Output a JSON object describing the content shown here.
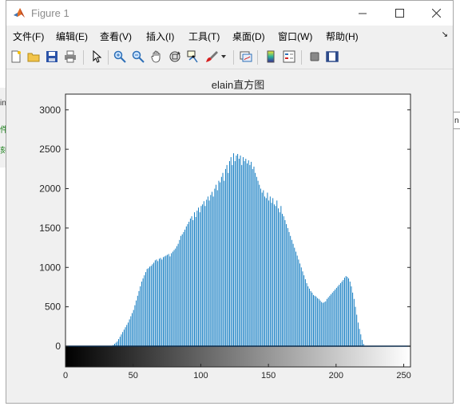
{
  "window": {
    "title": "Figure 1",
    "min_label": "Minimize",
    "max_label": "Maximize",
    "close_label": "Close"
  },
  "menu": [
    "文件(F)",
    "编辑(E)",
    "查看(V)",
    "插入(I)",
    "工具(T)",
    "桌面(D)",
    "窗口(W)",
    "帮助(H)"
  ],
  "toolbar": {
    "icons": [
      "new-figure-icon",
      "open-file-icon",
      "save-icon",
      "print-icon",
      "pointer-icon",
      "zoom-in-icon",
      "zoom-out-icon",
      "pan-icon",
      "rotate-3d-icon",
      "data-cursor-icon",
      "brush-icon",
      "link-plot-icon",
      "colorbar-icon",
      "legend-icon",
      "hide-plot-tools-icon",
      "show-plot-tools-icon"
    ]
  },
  "background": {
    "left_fragments": [
      "in",
      "件",
      "刻"
    ],
    "right_fragment": "n"
  },
  "chart_data": {
    "type": "bar",
    "title": "elain直方图",
    "xlabel": "",
    "ylabel": "",
    "xlim": [
      0,
      255
    ],
    "ylim": [
      0,
      3200
    ],
    "xticks": [
      0,
      50,
      100,
      150,
      200,
      250
    ],
    "yticks": [
      0,
      500,
      1000,
      1500,
      2000,
      2500,
      3000
    ],
    "bar_color": "#0072bd",
    "colorbar": "gray",
    "grid": false,
    "series": [
      {
        "x_start": 0,
        "values": [
          0,
          0,
          0,
          0,
          0,
          0,
          0,
          0,
          0,
          0,
          0,
          0,
          0,
          0,
          0,
          0,
          0,
          0,
          0,
          0,
          0,
          0,
          0,
          0,
          0,
          0,
          0,
          0,
          0,
          0,
          0,
          0,
          0,
          0,
          0,
          15,
          30,
          45,
          60,
          90,
          120,
          150,
          180,
          210,
          240,
          270,
          300,
          340,
          380,
          420,
          460,
          520,
          580,
          640,
          700,
          760,
          820,
          860,
          900,
          940,
          980,
          990,
          1010,
          1020,
          1040,
          1060,
          1090,
          1100,
          1080,
          1110,
          1120,
          1100,
          1130,
          1140,
          1150,
          1160,
          1170,
          1140,
          1180,
          1200,
          1220,
          1240,
          1270,
          1300,
          1350,
          1400,
          1420,
          1450,
          1480,
          1520,
          1550,
          1580,
          1620,
          1650,
          1600,
          1700,
          1640,
          1720,
          1760,
          1700,
          1780,
          1800,
          1840,
          1780,
          1860,
          1900,
          1850,
          1920,
          1960,
          1900,
          2000,
          2050,
          1980,
          2100,
          2080,
          2150,
          2200,
          2100,
          2250,
          2300,
          2200,
          2350,
          2400,
          2300,
          2450,
          2350,
          2420,
          2440,
          2380,
          2420,
          2300,
          2400,
          2350,
          2380,
          2320,
          2360,
          2300,
          2340,
          2250,
          2280,
          2200,
          2150,
          2100,
          2050,
          2000,
          1950,
          1980,
          1900,
          1880,
          1950,
          1850,
          1900,
          1820,
          1880,
          1800,
          1780,
          1850,
          1750,
          1700,
          1780,
          1680,
          1650,
          1600,
          1550,
          1500,
          1450,
          1400,
          1350,
          1300,
          1250,
          1200,
          1150,
          1100,
          1050,
          1000,
          950,
          900,
          850,
          800,
          760,
          730,
          700,
          680,
          650,
          640,
          630,
          610,
          600,
          580,
          560,
          550,
          560,
          570,
          600,
          620,
          640,
          660,
          680,
          700,
          720,
          740,
          760,
          780,
          800,
          820,
          840,
          870,
          890,
          880,
          860,
          820,
          760,
          680,
          600,
          500,
          400,
          300,
          220,
          150,
          80,
          30,
          0,
          0,
          0,
          0,
          0,
          0,
          0,
          0,
          0,
          0,
          0,
          0,
          0,
          0,
          0,
          0
        ]
      }
    ]
  }
}
